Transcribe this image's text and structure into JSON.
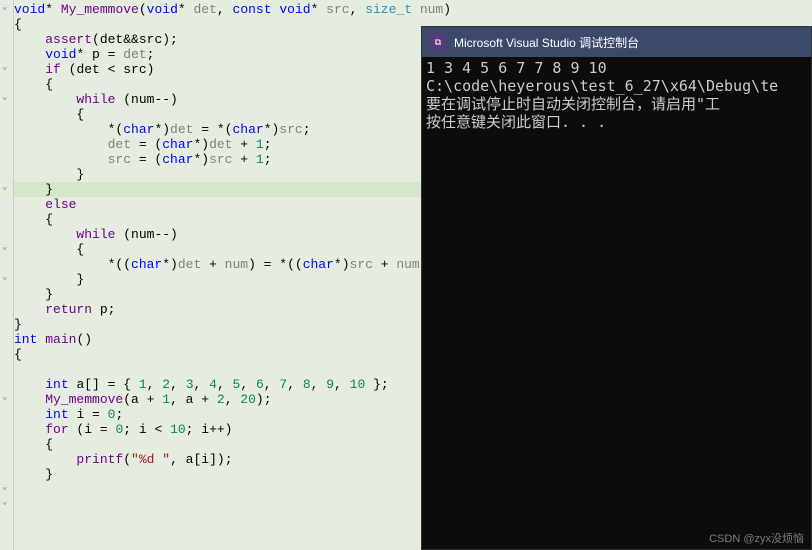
{
  "editor": {
    "line1": {
      "ret": "void",
      "ptr": "*",
      "fname": "My_memmove",
      "p1t": "void",
      "p1n": "det",
      "p2m": "const",
      "p2t": "void",
      "p2n": "src",
      "p3t": "size_t",
      "p3n": "num"
    },
    "assert": "assert",
    "assert_args": "(det&&src)",
    "decl_type": "void",
    "decl_name": "p",
    "decl_val": "det",
    "if_kw": "if",
    "if_cond": "(det < src)",
    "while_kw": "while",
    "while_cond": "(num--)",
    "cast": "char",
    "line_a": "*( char*)det = *( char*)src;",
    "line_b1": "det = (",
    "line_b2": ")det + ",
    "line_c1": "src = (",
    "line_c2": ")src + ",
    "one": "1",
    "else_kw": "else",
    "line_d1": "*((",
    "line_d2": ")det + num) = *((",
    "line_d3": ")src + num);",
    "return_kw": "return",
    "return_val": "p",
    "main_ret": "int",
    "main_name": "main",
    "arr_type": "int",
    "arr_name": "a[]",
    "arr_vals": [
      "1",
      "2",
      "3",
      "4",
      "5",
      "6",
      "7",
      "8",
      "9",
      "10"
    ],
    "call_name": "My_memmove",
    "call_args_a": "(a + ",
    "call_args_b": ", a + ",
    "call_args_c": ", ",
    "call_n1": "1",
    "call_n2": "2",
    "call_n3": "20",
    "decl_i_type": "int",
    "decl_i": "i",
    "zero": "0",
    "for_kw": "for",
    "for_lim": "10",
    "printf_name": "printf",
    "printf_fmt": "\"%d \"",
    "printf_arg": "a[i]"
  },
  "console": {
    "title": "Microsoft Visual Studio 调试控制台",
    "icon": "⧉",
    "output_line1": "1 3 4 5 6 7 7 8 9 10",
    "output_line2": "C:\\code\\heyerous\\test_6_27\\x64\\Debug\\te",
    "output_line3": "要在调试停止时自动关闭控制台，请启用\"工",
    "output_line4": "按任意键关闭此窗口. . ."
  },
  "watermark": "CSDN @zyx没烦恼"
}
